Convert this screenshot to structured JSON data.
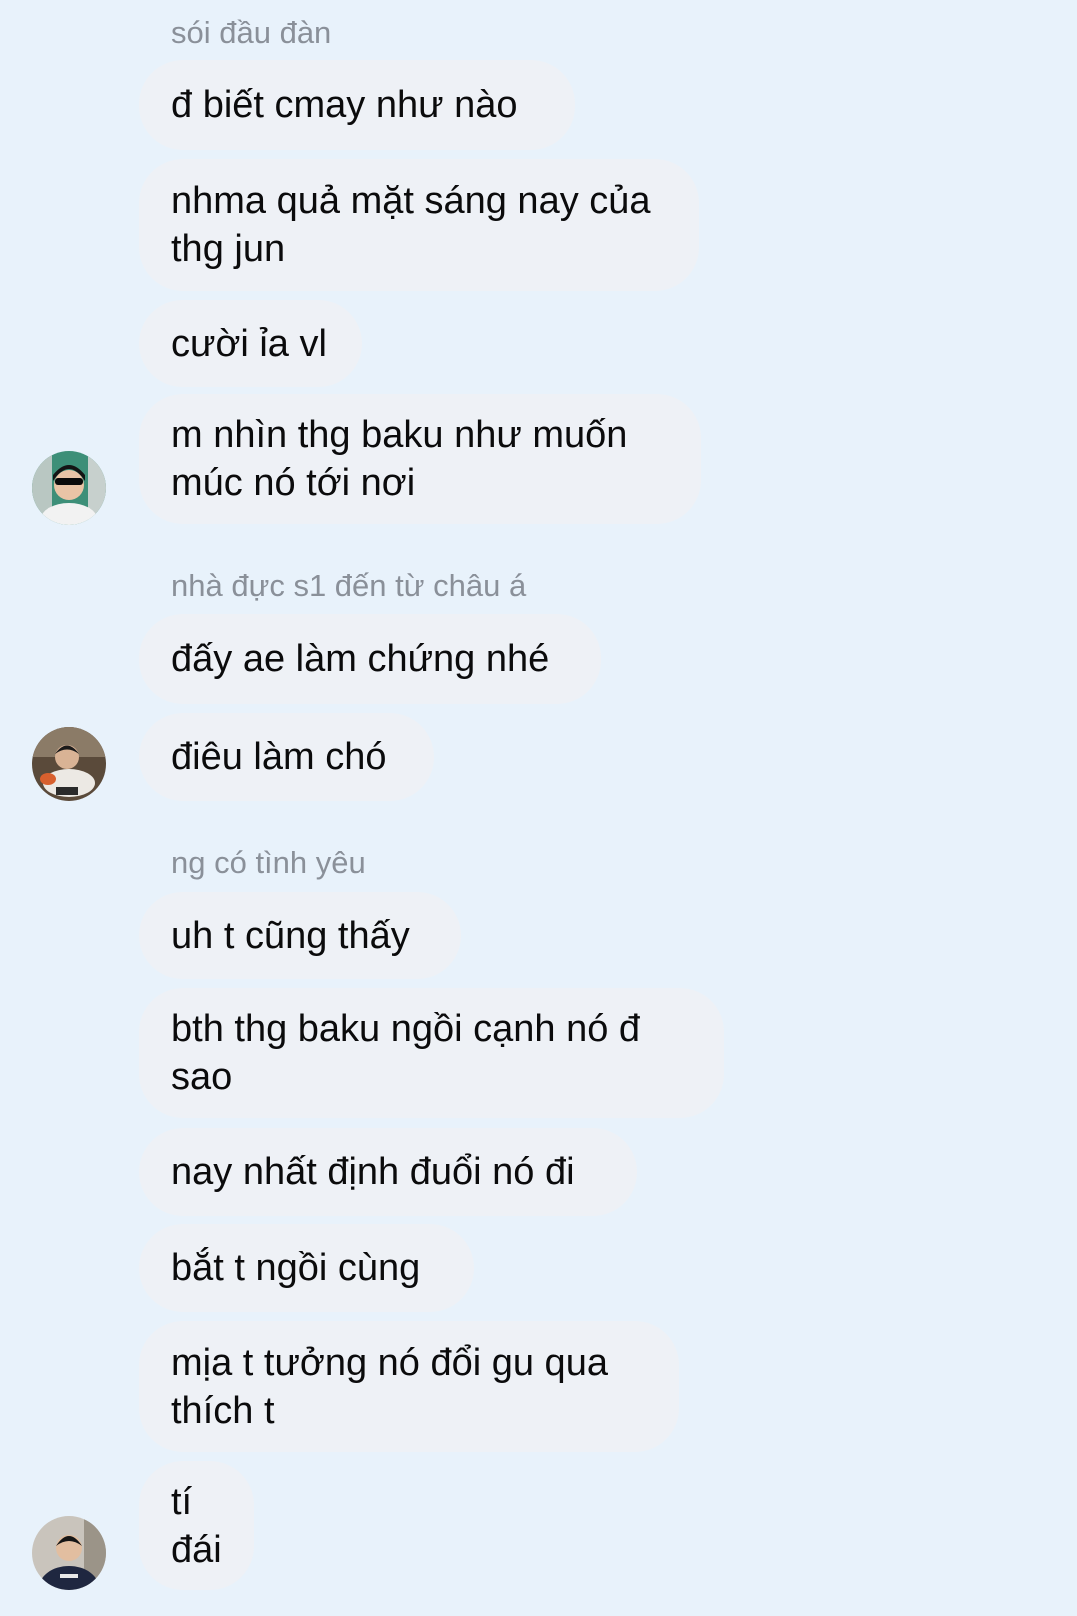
{
  "groups": [
    {
      "sender": "sói đầu đàn",
      "avatar_icon": "user-avatar-sunglasses",
      "messages": [
        "đ biết cmay như nào",
        "nhma quả mặt sáng nay của\nthg jun",
        "cười ỉa vl",
        "m nhìn thg baku như muốn\nmúc nó tới nơi"
      ]
    },
    {
      "sender": "nhà đực s1 đến từ châu á",
      "avatar_icon": "user-avatar-eating",
      "messages": [
        "đấy ae làm chứng nhé",
        "điêu làm chó"
      ]
    },
    {
      "sender": "ng có tình yêu",
      "avatar_icon": "user-avatar-dark-hoodie",
      "messages": [
        "uh t cũng thấy",
        "bth thg baku ngồi cạnh nó đ\nsao",
        "nay nhất định đuổi nó đi",
        "bắt t ngồi cùng",
        "mịa t tưởng nó đổi gu qua\nthích t",
        "tí\nđái"
      ]
    }
  ]
}
